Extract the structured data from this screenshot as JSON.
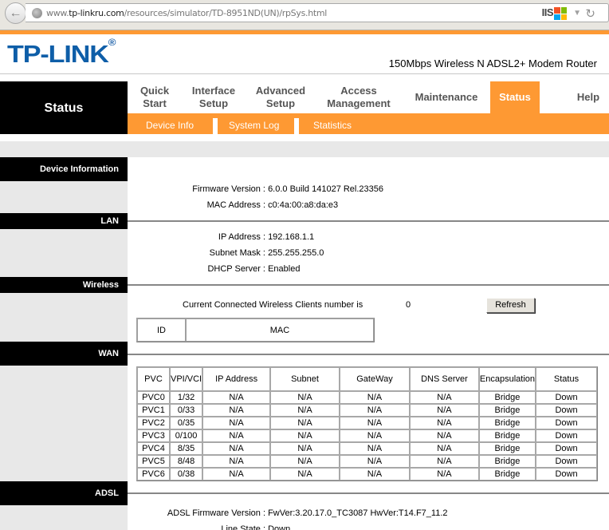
{
  "browser": {
    "url_prefix": "www.",
    "url_domain": "tp-linkru.com",
    "url_path": "/resources/simulator/TD-8951ND(UN)/rpSys.html",
    "server_badge": "IIS"
  },
  "banner": {
    "logo": "TP-LINK",
    "logo_mark": "®",
    "model": "150Mbps Wireless N ADSL2+ Modem Router"
  },
  "nav": {
    "section_title": "Status",
    "items": [
      {
        "label_line1": "Quick",
        "label_line2": "Start"
      },
      {
        "label_line1": "Interface",
        "label_line2": "Setup"
      },
      {
        "label_line1": "Advanced",
        "label_line2": "Setup"
      },
      {
        "label_line1": "Access",
        "label_line2": "Management"
      },
      {
        "label_line1": "Maintenance",
        "label_line2": ""
      },
      {
        "label_line1": "Status",
        "label_line2": ""
      },
      {
        "label_line1": "Help",
        "label_line2": ""
      }
    ],
    "active": "Status",
    "sub_items": [
      "Device Info",
      "System Log",
      "Statistics"
    ]
  },
  "sections": {
    "device_info": {
      "title": "Device Information",
      "firmware_label": "Firmware Version :",
      "firmware_value": "6.0.0 Build 141027 Rel.23356",
      "mac_label": "MAC Address :",
      "mac_value": "c0:4a:00:a8:da:e3"
    },
    "lan": {
      "title": "LAN",
      "ip_label": "IP Address :",
      "ip_value": "192.168.1.1",
      "mask_label": "Subnet Mask :",
      "mask_value": "255.255.255.0",
      "dhcp_label": "DHCP Server :",
      "dhcp_value": "Enabled"
    },
    "wireless": {
      "title": "Wireless",
      "clients_label": "Current Connected Wireless Clients number is",
      "clients_value": "0",
      "refresh_label": "Refresh",
      "table_headers": [
        "ID",
        "MAC"
      ]
    },
    "wan": {
      "title": "WAN",
      "headers": [
        "PVC",
        "VPI/VCI",
        "IP Address",
        "Subnet",
        "GateWay",
        "DNS Server",
        "Encapsulation",
        "Status"
      ],
      "rows": [
        [
          "PVC0",
          "1/32",
          "N/A",
          "N/A",
          "N/A",
          "N/A",
          "Bridge",
          "Down"
        ],
        [
          "PVC1",
          "0/33",
          "N/A",
          "N/A",
          "N/A",
          "N/A",
          "Bridge",
          "Down"
        ],
        [
          "PVC2",
          "0/35",
          "N/A",
          "N/A",
          "N/A",
          "N/A",
          "Bridge",
          "Down"
        ],
        [
          "PVC3",
          "0/100",
          "N/A",
          "N/A",
          "N/A",
          "N/A",
          "Bridge",
          "Down"
        ],
        [
          "PVC4",
          "8/35",
          "N/A",
          "N/A",
          "N/A",
          "N/A",
          "Bridge",
          "Down"
        ],
        [
          "PVC5",
          "8/48",
          "N/A",
          "N/A",
          "N/A",
          "N/A",
          "Bridge",
          "Down"
        ],
        [
          "PVC6",
          "0/38",
          "N/A",
          "N/A",
          "N/A",
          "N/A",
          "Bridge",
          "Down"
        ]
      ]
    },
    "adsl": {
      "title": "ADSL",
      "fw_label": "ADSL Firmware Version :",
      "fw_value": "FwVer:3.20.17.0_TC3087 HwVer:T14.F7_11.2",
      "line_label": "Line State :",
      "line_value": "Down"
    }
  },
  "colors": {
    "accent_orange": "#fe9933",
    "logo_blue": "#0e5ea8",
    "section_black": "#000000",
    "side_gray": "#e8e8e8"
  }
}
